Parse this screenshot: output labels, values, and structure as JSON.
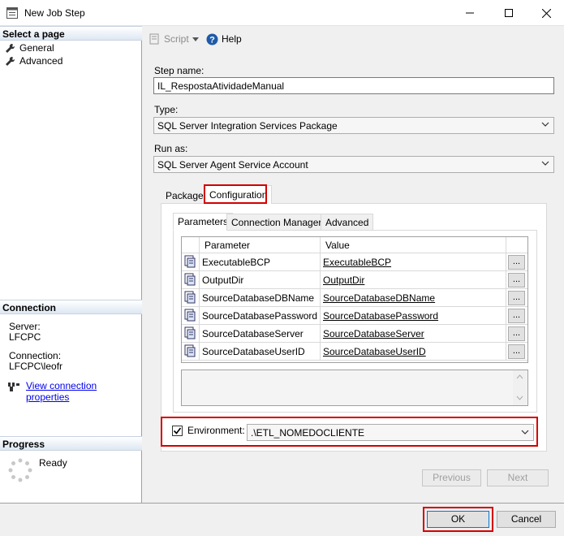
{
  "window": {
    "title": "New Job Step"
  },
  "left": {
    "select_page_header": "Select a page",
    "pages": [
      {
        "label": "General"
      },
      {
        "label": "Advanced"
      }
    ],
    "connection_header": "Connection",
    "server_label": "Server:",
    "server_value": "LFCPC",
    "connection_label": "Connection:",
    "connection_value": "LFCPC\\leofr",
    "view_connection_link": "View connection properties",
    "progress_header": "Progress",
    "progress_status": "Ready"
  },
  "toolbar": {
    "script_label": "Script",
    "help_label": "Help"
  },
  "form": {
    "step_name_label": "Step name:",
    "step_name_value": "IL_RespostaAtividadeManual",
    "type_label": "Type:",
    "type_value": "SQL Server Integration Services Package",
    "run_as_label": "Run as:",
    "run_as_value": "SQL Server Agent Service Account"
  },
  "tabs": {
    "package": "Package",
    "configuration": "Configuration"
  },
  "inner_tabs": {
    "parameters": "Parameters",
    "connection_managers": "Connection Managers",
    "advanced": "Advanced"
  },
  "grid": {
    "columns": {
      "parameter": "Parameter",
      "value": "Value"
    },
    "ellipsis": "...",
    "rows": [
      {
        "parameter": "ExecutableBCP",
        "value": "ExecutableBCP"
      },
      {
        "parameter": "OutputDir",
        "value": "OutputDir"
      },
      {
        "parameter": "SourceDatabaseDBName",
        "value": "SourceDatabaseDBName"
      },
      {
        "parameter": "SourceDatabasePassword",
        "value": "SourceDatabasePassword"
      },
      {
        "parameter": "SourceDatabaseServer",
        "value": "SourceDatabaseServer"
      },
      {
        "parameter": "SourceDatabaseUserID",
        "value": "SourceDatabaseUserID"
      }
    ]
  },
  "environment": {
    "label": "Environment:",
    "value": ".\\ETL_NOMEDOCLIENTE",
    "checked": true
  },
  "buttons": {
    "previous": "Previous",
    "next": "Next",
    "ok": "OK",
    "cancel": "Cancel"
  },
  "colors": {
    "highlight_red": "#d40000",
    "link_blue": "#0000ee",
    "ok_border": "#0078d7"
  }
}
